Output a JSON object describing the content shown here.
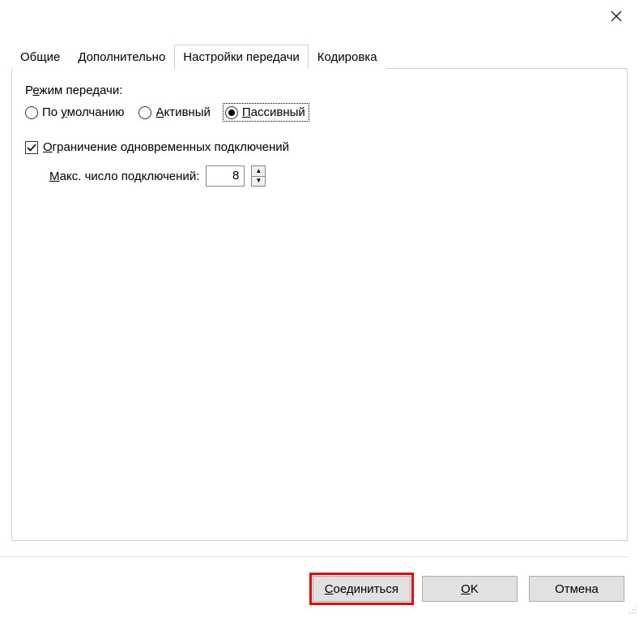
{
  "titlebar": {
    "close_tooltip": "Закрыть"
  },
  "tabs": {
    "general": "Общие",
    "advanced": "Дополнительно",
    "transfer": "Настройки передачи",
    "encoding": "Кодировка"
  },
  "transfer_panel": {
    "mode_label": "Режим передачи:",
    "mode_label_before": "Р",
    "mode_label_ul": "е",
    "mode_label_after": "жим передачи:",
    "radio_default_before": "По ",
    "radio_default_ul": "у",
    "radio_default_after": "молчанию",
    "radio_active_ul": "А",
    "radio_active_after": "ктивный",
    "radio_passive_ul": "П",
    "radio_passive_after": "ассивный",
    "limit_ul": "О",
    "limit_after": "граничение одновременных подключений",
    "max_conn_ul": "М",
    "max_conn_after": "акс. число подключений:",
    "max_conn_value": "8"
  },
  "buttons": {
    "connect_ul": "С",
    "connect_after": "оединиться",
    "ok_before": "",
    "ok_ul": "O",
    "ok_after": "K",
    "cancel": "Отмена"
  }
}
